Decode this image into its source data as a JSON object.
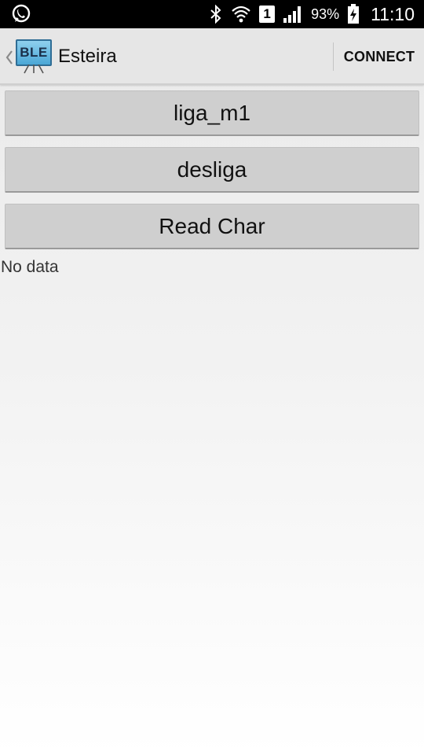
{
  "status_bar": {
    "battery_percent": "93%",
    "time": "11:10",
    "sim_slot": "1",
    "icons": [
      "whatsapp-icon",
      "bluetooth-icon",
      "wifi-icon",
      "sim-icon",
      "signal-icon",
      "battery-charging-icon"
    ]
  },
  "action_bar": {
    "app_icon_text": "BLE",
    "title": "Esteira",
    "connect_label": "CONNECT"
  },
  "buttons": [
    {
      "label": "liga_m1"
    },
    {
      "label": "desliga"
    },
    {
      "label": "Read Char"
    }
  ],
  "data_label": "No data",
  "colors": {
    "status_bar_bg": "#000000",
    "action_bar_bg": "#e6e6e6",
    "button_bg": "#cfcfcf",
    "app_icon_blue": "#4aa7d6"
  }
}
